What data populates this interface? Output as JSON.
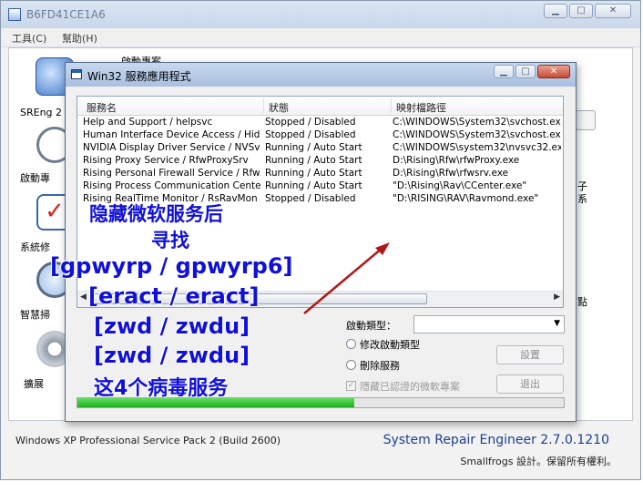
{
  "main_window": {
    "title": "B6FD41CE1A6",
    "menu": [
      "工具(C)",
      "幫助(H)"
    ],
    "header_text": "啟動專案",
    "sidebar": [
      {
        "label": "SREng 2",
        "icon": "repair-tool-icon"
      },
      {
        "label": "啟動專",
        "icon": "clock-icon"
      },
      {
        "label": "系統修",
        "icon": "checklist-icon"
      },
      {
        "label": "智慧掃",
        "icon": "magnifier-icon"
      },
      {
        "label": "擴展",
        "icon": "gear-icon"
      }
    ],
    "right_edge_text": [
      "子",
      "系",
      "點"
    ],
    "status_left": "Windows XP Professional Service Pack 2 (Build 2600)",
    "version": "System Repair Engineer 2.7.0.1210",
    "copyright": "Smallfrogs 設計。保留所有權利。"
  },
  "dialog": {
    "title": "Win32 服務應用程式",
    "columns": [
      "服務名",
      "狀態",
      "映射檔路徑"
    ],
    "rows": [
      [
        "Help and Support / helpsvc",
        "Stopped / Disabled",
        "C:\\WINDOWS\\System32\\svchost.exe"
      ],
      [
        "Human Interface Device Access / Hid...",
        "Stopped / Disabled",
        "C:\\WINDOWS\\System32\\svchost.exe"
      ],
      [
        "NVIDIA Display Driver Service / NVSvc",
        "Running / Auto Start",
        "C:\\WINDOWS\\system32\\nvsvc32.exe"
      ],
      [
        "Rising Proxy  Service / RfwProxySrv",
        "Running / Auto Start",
        "D:\\Rising\\Rfw\\rfwProxy.exe"
      ],
      [
        "Rising Personal Firewall Service / Rfw...",
        "Running / Auto Start",
        "D:\\Rising\\Rfw\\rfwsrv.exe"
      ],
      [
        "Rising Process Communication Center...",
        "Running / Auto Start",
        "\"D:\\Rising\\Rav\\CCenter.exe\""
      ],
      [
        "Rising RealTime Monitor / RsRavMon",
        "Stopped / Disabled",
        "\"D:\\RISING\\RAV\\Ravmond.exe\""
      ]
    ],
    "startup_type_label": "啟動類型：",
    "startup_type_value": "",
    "radio_change": "修改啟動類型",
    "radio_delete": "刪除服務",
    "hide_ms_label": "隱藏已認證的微軟專案",
    "hide_ms_checked": true,
    "set_button": "設置",
    "exit_button": "退出",
    "progress": 0.57
  },
  "annotation": {
    "lines": [
      "隐藏微软服务后",
      "寻找",
      "[gpwyrp / gpwyrp6]",
      "[eract / eract]",
      "[zwd / zwdu]",
      "[zwd / zwdu]",
      "这4个病毒服务"
    ],
    "color": "#1010d8",
    "arrow_color": "#b01818"
  }
}
